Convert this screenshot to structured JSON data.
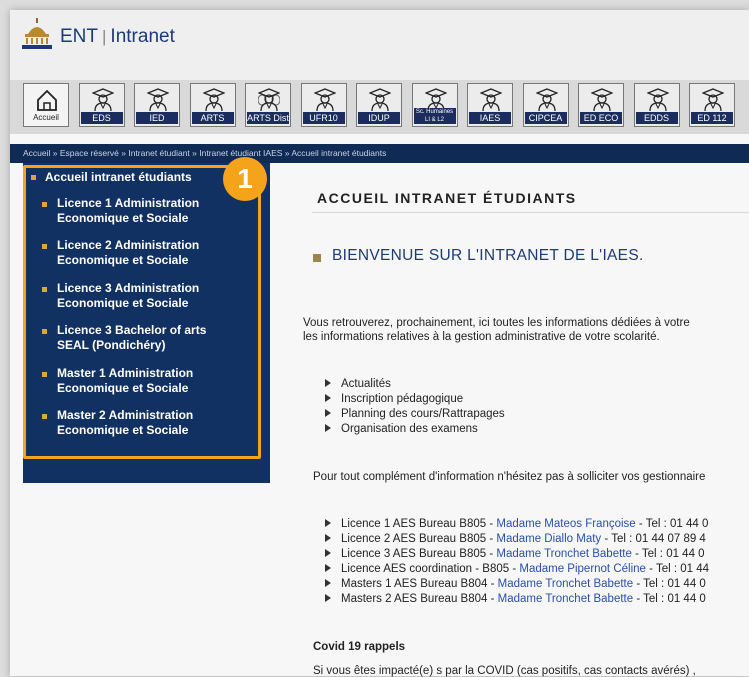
{
  "header": {
    "logo_text": "ENT",
    "separator": "|",
    "title": "Intranet"
  },
  "nav": [
    {
      "label": "Accueil",
      "icon": "home-icon"
    },
    {
      "label": "EDS",
      "icon": "graduate-icon"
    },
    {
      "label": "IED",
      "icon": "graduate-icon"
    },
    {
      "label": "ARTS",
      "icon": "graduate-icon"
    },
    {
      "label": "ARTS Dist",
      "icon": "graduate-cloud-icon"
    },
    {
      "label": "UFR10",
      "icon": "graduate-icon"
    },
    {
      "label": "IDUP",
      "icon": "graduate-icon"
    },
    {
      "label": "Sc. Humaines LI & L2",
      "icon": "graduate-icon"
    },
    {
      "label": "IAES",
      "icon": "graduate-icon"
    },
    {
      "label": "CIPCEA",
      "icon": "graduate-icon"
    },
    {
      "label": "ED ECO",
      "icon": "graduate-icon"
    },
    {
      "label": "EDDS",
      "icon": "graduate-icon"
    },
    {
      "label": "ED 112",
      "icon": "graduate-icon"
    }
  ],
  "breadcrumb": "Accueil » Espace réservé » Intranet étudiant » Intranet étudiant IAES » Accueil intranet étudiants",
  "sidebar": {
    "title": "Accueil intranet étudiants",
    "items": [
      {
        "line1": "Licence 1 Administration",
        "line2": "Economique et Sociale"
      },
      {
        "line1": "Licence 2 Administration",
        "line2": "Economique et Sociale"
      },
      {
        "line1": "Licence 3 Administration",
        "line2": "Economique et Sociale"
      },
      {
        "line1": "Licence 3 Bachelor of arts",
        "line2": "SEAL (Pondichéry)"
      },
      {
        "line1": "Master 1 Administration",
        "line2": "Economique et Sociale"
      },
      {
        "line1": "Master 2 Administration",
        "line2": "Economique et Sociale"
      }
    ],
    "badge": "1"
  },
  "content": {
    "heading": "ACCUEIL INTRANET ÉTUDIANTS",
    "welcome": "BIENVENUE SUR L'INTRANET DE L'IAES.",
    "intro_line1": "Vous retrouverez, prochainement, ici toutes les informations dédiées à votre",
    "intro_line2": "les informations relatives à la gestion administrative de votre scolarité.",
    "topics": [
      "Actualités",
      "Inscription pédagogique",
      "Planning des cours/Rattrapages",
      "Organisation des examens"
    ],
    "contact_intro": "Pour tout complément d'information n'hésitez pas à solliciter vos gestionnaire",
    "contacts": [
      {
        "prefix": "Licence 1 AES Bureau B805 - ",
        "name": "Madame Mateos Françoise",
        "suffix": " - Tel : 01 44 0"
      },
      {
        "prefix": "Licence 2 AES Bureau B805 - ",
        "name": "Madame Diallo Maty",
        "suffix": " - Tel : 01 44 07 89 4"
      },
      {
        "prefix": "Licence 3 AES Bureau B805 - ",
        "name": "Madame Tronchet Babette",
        "suffix": " - Tel : 01 44 0"
      },
      {
        "prefix": "Licence AES coordination - B805 - ",
        "name": "Madame Pipernot Céline",
        "suffix": " - Tel : 01 44"
      },
      {
        "prefix": "Masters 1 AES Bureau B804 - ",
        "name": "Madame Tronchet Babette",
        "suffix": " - Tel : 01 44 0"
      },
      {
        "prefix": "Masters 2 AES Bureau B804 - ",
        "name": "Madame Tronchet Babette",
        "suffix": " - Tel : 01 44 0"
      }
    ],
    "covid_title": "Covid 19 rappels",
    "covid_text": "Si vous êtes impacté(e) s par la COVID (cas positifs, cas contacts avérés) ,"
  },
  "colors": {
    "navy": "#123163",
    "crumb_bar": "#0e2a55",
    "highlight": "#f5a31a",
    "link": "#2a4fb0",
    "bullet": "#d8a83a"
  }
}
